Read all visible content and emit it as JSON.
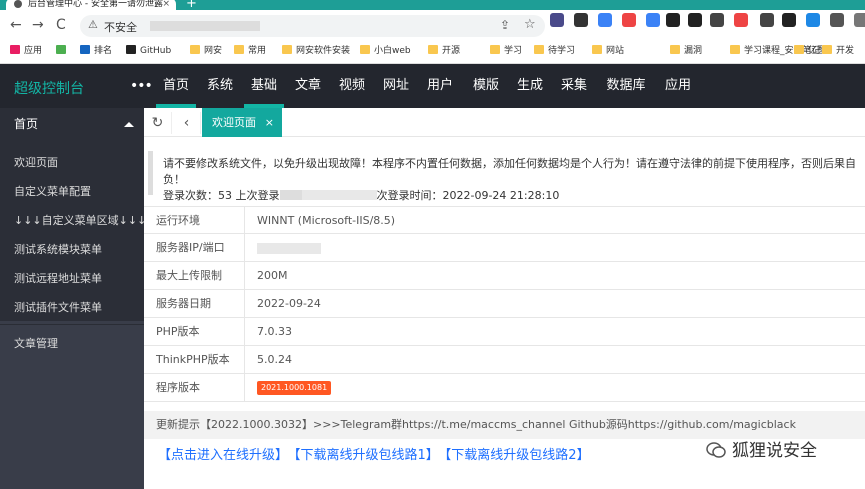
{
  "browser": {
    "tab_title": "后台管理中心 - 安全第一请勿泄露",
    "tab_close": "×",
    "new_tab": "+",
    "back": "←",
    "forward": "→",
    "reload": "C",
    "not_secure": "不安全",
    "share": "⇪",
    "star": "☆",
    "extensions": [
      "#4a4a8a",
      "#333",
      "#3b82f6",
      "#e44",
      "#3b82f6",
      "#222",
      "#222",
      "#444",
      "#e44",
      "#444",
      "#222",
      "#1e88e5",
      "#555",
      "#777"
    ],
    "bookmarks": [
      {
        "label": "应用",
        "color": "#e91e63"
      },
      {
        "label": "",
        "color": "#4caf50"
      },
      {
        "label": "排名",
        "color": "#1565c0"
      },
      {
        "label": "GitHub",
        "color": "#222"
      },
      {
        "label": "网安",
        "color": "#f9c74f"
      },
      {
        "label": "常用",
        "color": "#f9c74f"
      },
      {
        "label": "网安软件安装",
        "color": "#f9c74f"
      },
      {
        "label": "小白web",
        "color": "#f9c74f"
      },
      {
        "label": "开源",
        "color": "#f9c74f"
      },
      {
        "label": "学习",
        "color": "#f9c74f"
      },
      {
        "label": "待学习",
        "color": "#f9c74f"
      },
      {
        "label": "网站",
        "color": "#f9c74f"
      },
      {
        "label": "漏洞",
        "color": "#f9c74f"
      },
      {
        "label": "学习课程_安全笔记",
        "color": "#f9c74f"
      },
      {
        "label": "亿图",
        "color": "#f9c74f"
      },
      {
        "label": "开发",
        "color": "#f9c74f"
      }
    ]
  },
  "header": {
    "brand": "超级控制台",
    "dots": "•••",
    "menu": [
      "首页",
      "系统",
      "基础",
      "文章",
      "视频",
      "网址",
      "用户",
      "模版",
      "生成",
      "采集",
      "数据库",
      "应用"
    ]
  },
  "sidebar": {
    "head": "首页",
    "items": [
      "欢迎页面",
      "自定义菜单配置",
      "↓↓↓自定义菜单区域↓↓↓",
      "测试系统模块菜单",
      "测试远程地址菜单",
      "测试插件文件菜单"
    ],
    "article": "文章管理"
  },
  "tabbar": {
    "refresh": "↻",
    "back": "‹",
    "active_tab": "欢迎页面",
    "close": "×"
  },
  "notice": {
    "line1": "请不要修改系统文件，以免升级出现故障！本程序不内置任何数据，添加任何数据均是个人行为！请在遵守法律的前提下使用程序，否则后果自负！",
    "line2_a": "登录次数：53 上次登录",
    "line2_b": "次登录时间：2022-09-24 21:28:10"
  },
  "info": [
    {
      "label": "运行环境",
      "value": "WINNT (Microsoft-IIS/8.5)"
    },
    {
      "label": "服务器IP/端口",
      "value": ""
    },
    {
      "label": "最大上传限制",
      "value": "200M"
    },
    {
      "label": "服务器日期",
      "value": "2022-09-24"
    },
    {
      "label": "PHP版本",
      "value": "7.0.33"
    },
    {
      "label": "ThinkPHP版本",
      "value": "5.0.24"
    },
    {
      "label": "程序版本",
      "value": "2021.1000.1081"
    }
  ],
  "update": "更新提示【2022.1000.3032】>>>Telegram群https://t.me/maccms_channel   Github源码https://github.com/magicblack",
  "links": [
    "【点击进入在线升级】",
    "【下载离线升级包线路1】",
    "【下载离线升级包线路2】"
  ],
  "watermark": "狐狸说安全",
  "colors": {
    "accent": "#13b5a5",
    "topbar": "#23262e",
    "sidebar": "#393d49",
    "badge": "#ff5722",
    "link": "#1e6fff"
  }
}
